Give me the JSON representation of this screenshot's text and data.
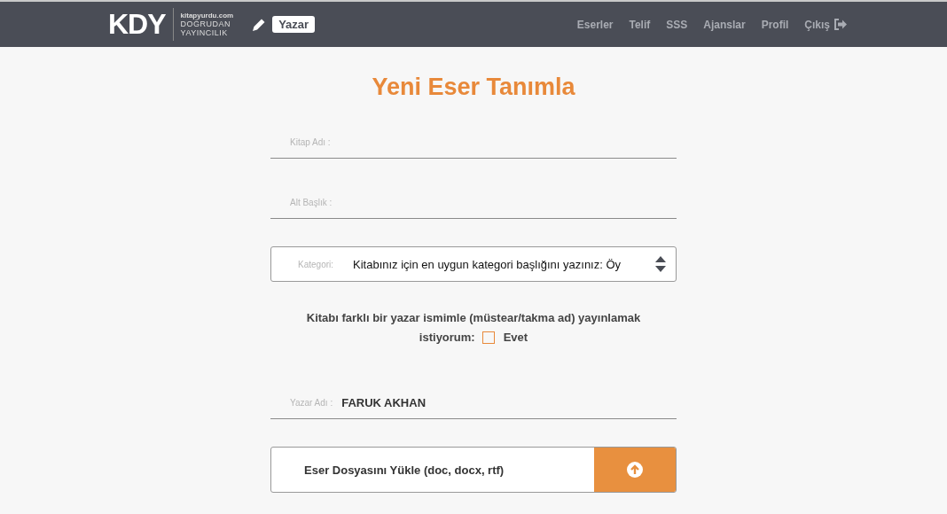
{
  "header": {
    "logo": {
      "mark": "KDY",
      "site": "kitapyurdu.com",
      "line1": "DOĞRUDAN",
      "line2": "YAYINCILIK"
    },
    "role_badge": "Yazar",
    "nav": [
      {
        "label": "Eserler",
        "kind": "link"
      },
      {
        "label": "Telif",
        "kind": "link"
      },
      {
        "label": "SSS",
        "kind": "link"
      },
      {
        "label": "Ajanslar",
        "kind": "link"
      },
      {
        "label": "Profil",
        "kind": "link"
      },
      {
        "label": "Çıkış",
        "kind": "logout"
      }
    ]
  },
  "title": "Yeni Eser Tanımla",
  "fields": [
    {
      "kind": "text",
      "label": "Kitap Adı :"
    },
    {
      "kind": "text",
      "label": "Alt Başlık :"
    },
    {
      "kind": "select",
      "label": "Kategori:",
      "value": "Kitabınız için en uygun kategori başlığını yazınız: Öy"
    }
  ],
  "pseudonym": {
    "question_lines": [
      "Kitabı farklı bir yazar ismimle (müstear/takma ad) yayınlamak",
      "istiyorum:"
    ],
    "checked": false,
    "option": "Evet"
  },
  "author_field": {
    "label": "Yazar Adı :",
    "value": "FARUK AKHAN"
  },
  "upload": {
    "label": "Eser Dosyasını Yükle (doc, docx, rtf)"
  }
}
